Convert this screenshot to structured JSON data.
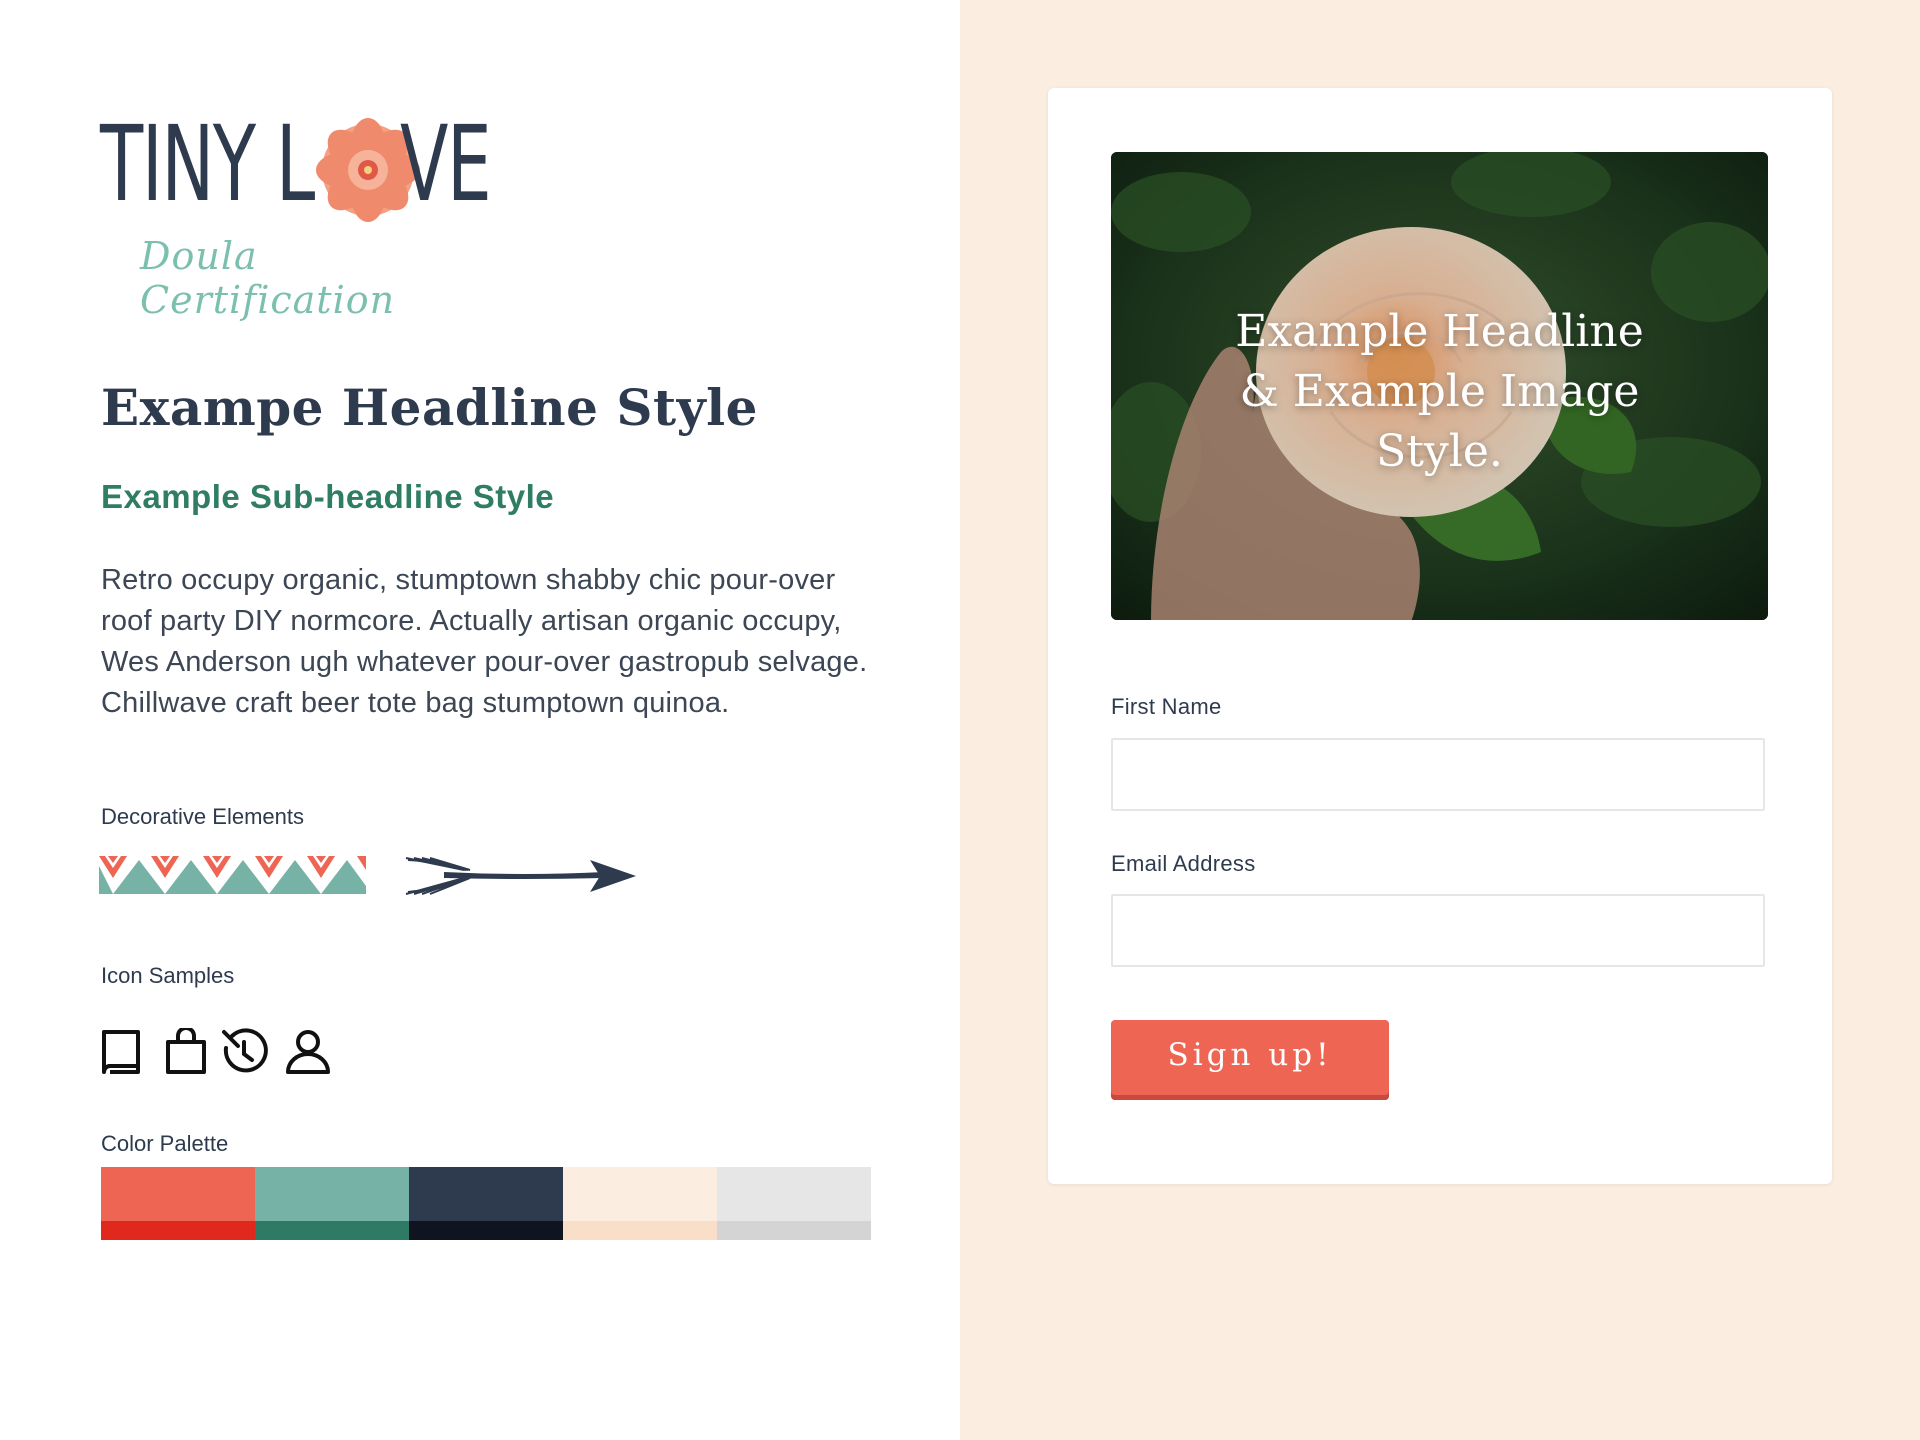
{
  "brand": {
    "logo_word_left": "TINY L",
    "logo_word_right": "VE",
    "tagline": "Doula Certification"
  },
  "styleguide": {
    "headline": "Exampe Headline Style",
    "subheadline": "Example Sub-headline Style",
    "body": "Retro occupy organic, stumptown shabby chic pour-over roof party DIY normcore. Actually artisan organic occupy, Wes Anderson ugh whatever pour-over gastropub selvage. Chillwave craft beer tote bag stumptown quinoa.",
    "decorative_label": "Decorative Elements",
    "icons_label": "Icon Samples",
    "icons": [
      "book-icon",
      "shopping-bag-icon",
      "history-clock-icon",
      "user-icon"
    ],
    "palette_label": "Color Palette",
    "palette": [
      {
        "main": "#ee6554",
        "dark": "#e1281c"
      },
      {
        "main": "#76b2a6",
        "dark": "#2e7a64"
      },
      {
        "main": "#2e3b4e",
        "dark": "#0f1420"
      },
      {
        "main": "#fbeee1",
        "dark": "#f9dfc7"
      },
      {
        "main": "#e6e6e6",
        "dark": "#d4d4d4"
      }
    ]
  },
  "signup_card": {
    "hero_lines": [
      "Example Headline",
      "& Example Image",
      "Style."
    ],
    "first_name_label": "First Name",
    "first_name_value": "",
    "email_label": "Email Address",
    "email_value": "",
    "submit_label": "Sign up!"
  },
  "colors": {
    "page_right_bg": "#fbeee1",
    "text_dark": "#2e3b4e",
    "accent_green": "#2f7d64",
    "button": "#ee6554"
  }
}
